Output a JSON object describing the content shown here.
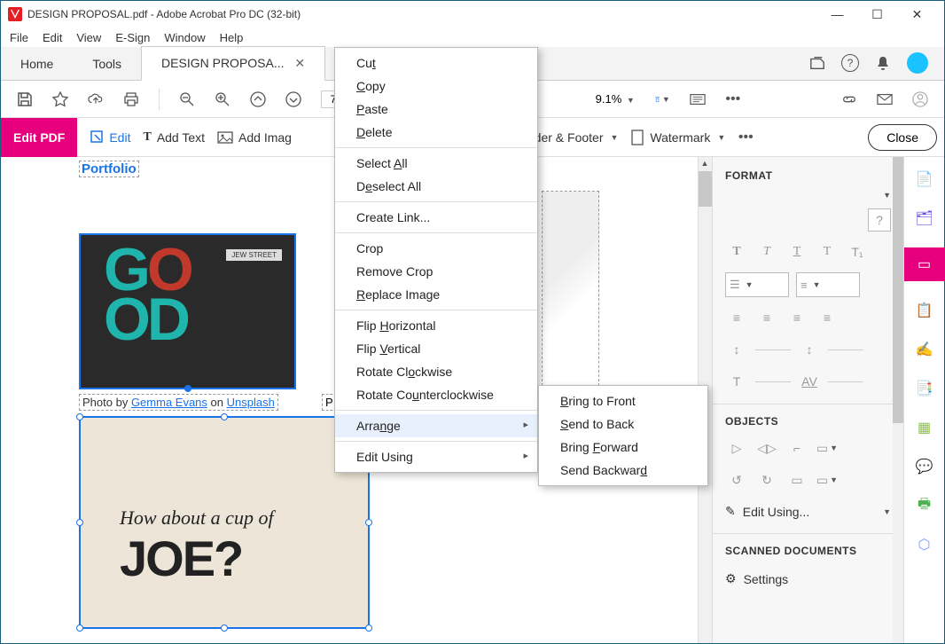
{
  "titlebar": {
    "title": "DESIGN PROPOSAL.pdf - Adobe Acrobat Pro DC (32-bit)"
  },
  "menubar": [
    "File",
    "Edit",
    "View",
    "E-Sign",
    "Window",
    "Help"
  ],
  "tabs": {
    "home": "Home",
    "tools": "Tools",
    "doc": "DESIGN PROPOSA..."
  },
  "toolbar": {
    "page_current": "7",
    "page_sep": "/",
    "zoom": "9.1%"
  },
  "editbar": {
    "title": "Edit PDF",
    "edit": "Edit",
    "add_text": "Add Text",
    "add_image": "Add Imag",
    "header_footer": "Header & Footer",
    "watermark": "Watermark",
    "close": "Close"
  },
  "doc": {
    "portfolio": "Portfolio",
    "jew_street": "JEW STREET",
    "caption_prefix": "Photo by ",
    "caption_link1": "Gemma Evans",
    "caption_mid": " on ",
    "caption_link2": "Unsplash",
    "caption_right_prefix": "P",
    "joe_line1": "How about a cup of",
    "joe_line2": "JOE?"
  },
  "context_menu": {
    "cut": "Cut",
    "copy": "Copy",
    "paste": "Paste",
    "delete": "Delete",
    "select_all": "Select All",
    "deselect_all": "Deselect All",
    "create_link": "Create Link...",
    "crop": "Crop",
    "remove_crop": "Remove Crop",
    "replace_image": "Replace Image",
    "flip_h": "Flip Horizontal",
    "flip_v": "Flip Vertical",
    "rotate_cw": "Rotate Clockwise",
    "rotate_ccw": "Rotate Counterclockwise",
    "arrange": "Arrange",
    "edit_using": "Edit Using"
  },
  "submenu": {
    "bring_front": "Bring to Front",
    "send_back": "Send to Back",
    "bring_forward": "Bring Forward",
    "send_backward": "Send Backward"
  },
  "format_panel": {
    "header": "FORMAT",
    "objects_header": "OBJECTS",
    "edit_using": "Edit Using...",
    "scanned_header": "SCANNED DOCUMENTS",
    "settings": "Settings"
  },
  "rail_colors": {
    "create": "#e6007e",
    "export": "#6b4de6",
    "edit": "#e6007e",
    "organize": "#e6007e",
    "comment": "#1fb5ad",
    "fill": "#6b4de6",
    "sig": "#1fb5ad",
    "redact": "#8bc34a",
    "prepare": "#ffb300",
    "protect": "#7b68ee",
    "more": "#4caf50"
  }
}
